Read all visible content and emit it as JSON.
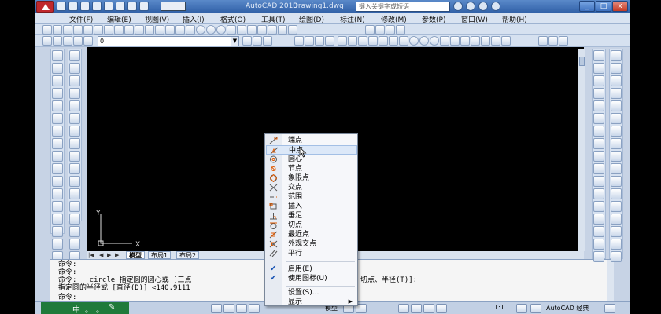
{
  "titlebar": {
    "app_title": "AutoCAD 2010",
    "doc_title": "Drawing1.dwg",
    "search_placeholder": "键入关键字或短语",
    "window_buttons": [
      "_",
      "□",
      "x"
    ]
  },
  "menubar": {
    "items": [
      "文件(F)",
      "编辑(E)",
      "视图(V)",
      "插入(I)",
      "格式(O)",
      "工具(T)",
      "绘图(D)",
      "标注(N)",
      "修改(M)",
      "参数(P)",
      "窗口(W)",
      "帮助(H)"
    ]
  },
  "layer_toolbar": {
    "current_layer": "0"
  },
  "layout_tabs": {
    "items": [
      "模型",
      "布局1",
      "布局2"
    ],
    "active": "模型"
  },
  "command_window": {
    "lines": [
      "命令:",
      "命令:",
      "命令:   circle 指定圆的圆心或 [三点",
      "指定圆的半径或 [直径(D)] <140.9111",
      "命令:"
    ],
    "continuation": "切点、半径(T)]:"
  },
  "statusbar": {
    "osnap_toast": [
      "中",
      "。",
      "。",
      "✎"
    ],
    "model_label": "模型",
    "scale": "1:1",
    "workspace": "AutoCAD 经典"
  },
  "ucs": {
    "y_label": "Y",
    "x_label": "X"
  },
  "context_menu": {
    "items": [
      {
        "icon": "endpoint-icon",
        "label": "端点"
      },
      {
        "icon": "midpoint-icon",
        "label": "中点"
      },
      {
        "icon": "center-icon",
        "label": "圆心"
      },
      {
        "icon": "node-icon",
        "label": "节点"
      },
      {
        "icon": "quadrant-icon",
        "label": "象限点"
      },
      {
        "icon": "intersection-icon",
        "label": "交点"
      },
      {
        "icon": "extension-icon",
        "label": "范围"
      },
      {
        "icon": "insertion-icon",
        "label": "插入"
      },
      {
        "icon": "perpendicular-icon",
        "label": "垂足"
      },
      {
        "icon": "tangent-icon",
        "label": "切点"
      },
      {
        "icon": "nearest-icon",
        "label": "最近点"
      },
      {
        "icon": "apparent-intersection-icon",
        "label": "外观交点"
      },
      {
        "icon": "parallel-icon",
        "label": "平行"
      }
    ],
    "toggles": [
      {
        "label": "启用(E)",
        "checked": true
      },
      {
        "label": "使用图标(U)",
        "checked": true
      }
    ],
    "settings_label": "设置(S)...",
    "display_label": "显示",
    "highlighted": "中点"
  }
}
